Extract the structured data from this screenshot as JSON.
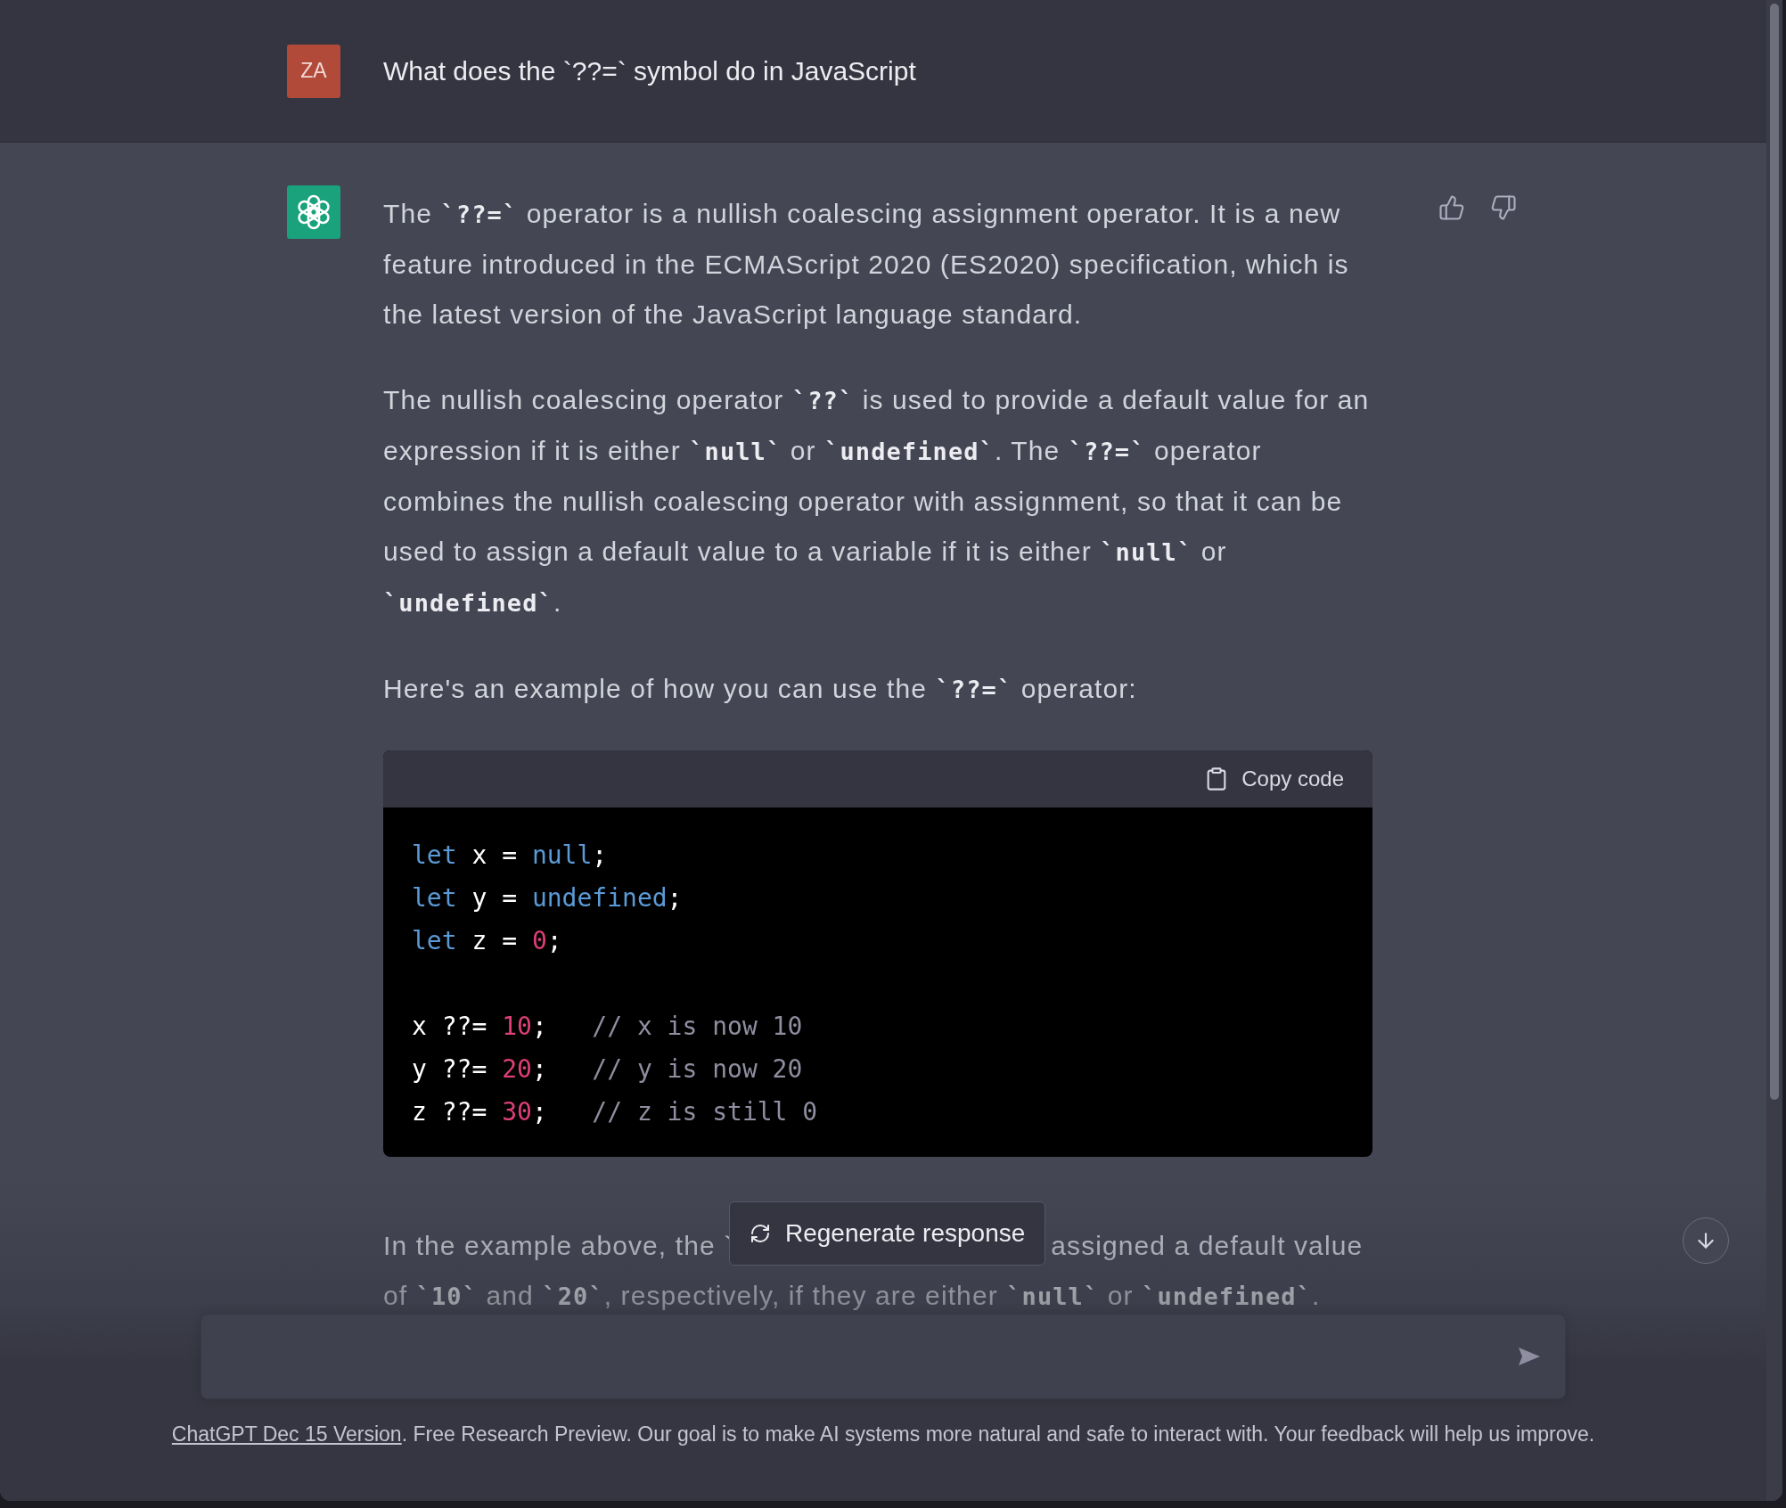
{
  "question": {
    "avatar": "ZA",
    "text": "What does the `??=` symbol do in JavaScript"
  },
  "answer": {
    "blocks": [
      {
        "kind": "paragraph",
        "segments": [
          {
            "text": "The "
          },
          {
            "text": "`??=`",
            "code": true
          },
          {
            "text": " operator is a nullish coalescing assignment operator. It is a new feature introduced in the ECMAScript 2020 (ES2020) specification, which is the latest version of the JavaScript language standard."
          }
        ]
      },
      {
        "kind": "paragraph",
        "segments": [
          {
            "text": "The nullish coalescing operator "
          },
          {
            "text": "`??`",
            "code": true
          },
          {
            "text": " is used to provide a default value for an expression if it is either "
          },
          {
            "text": "`null`",
            "code": true
          },
          {
            "text": " or "
          },
          {
            "text": "`undefined`",
            "code": true
          },
          {
            "text": ". The "
          },
          {
            "text": "`??=`",
            "code": true
          },
          {
            "text": " operator combines the nullish coalescing operator with assignment, so that it can be used to assign a default value to a variable if it is either "
          },
          {
            "text": "`null`",
            "code": true
          },
          {
            "text": " or "
          },
          {
            "text": "`undefined`",
            "code": true
          },
          {
            "text": "."
          }
        ]
      },
      {
        "kind": "paragraph",
        "segments": [
          {
            "text": "Here's an example of how you can use the "
          },
          {
            "text": "`??=`",
            "code": true
          },
          {
            "text": " operator:"
          }
        ]
      },
      {
        "kind": "code",
        "copy_label": "Copy code",
        "groups": [
          [
            [
              {
                "kind": "keyword",
                "text": "let"
              },
              {
                "kind": "plain",
                "text": " x = "
              },
              {
                "kind": "keyword",
                "text": "null"
              },
              {
                "kind": "plain",
                "text": ";"
              }
            ],
            [
              {
                "kind": "keyword",
                "text": "let"
              },
              {
                "kind": "plain",
                "text": " y = "
              },
              {
                "kind": "keyword",
                "text": "undefined"
              },
              {
                "kind": "plain",
                "text": ";"
              }
            ],
            [
              {
                "kind": "keyword",
                "text": "let"
              },
              {
                "kind": "plain",
                "text": " z = "
              },
              {
                "kind": "number",
                "text": "0"
              },
              {
                "kind": "plain",
                "text": ";"
              }
            ]
          ],
          [
            [
              {
                "kind": "plain",
                "text": "x ??= "
              },
              {
                "kind": "number",
                "text": "10"
              },
              {
                "kind": "plain",
                "text": ";   "
              },
              {
                "kind": "comment",
                "text": "// x is now 10"
              }
            ],
            [
              {
                "kind": "plain",
                "text": "y ??= "
              },
              {
                "kind": "number",
                "text": "20"
              },
              {
                "kind": "plain",
                "text": ";   "
              },
              {
                "kind": "comment",
                "text": "// y is now 20"
              }
            ],
            [
              {
                "kind": "plain",
                "text": "z ??= "
              },
              {
                "kind": "number",
                "text": "30"
              },
              {
                "kind": "plain",
                "text": ";   "
              },
              {
                "kind": "comment",
                "text": "// z is still 0"
              }
            ]
          ]
        ]
      },
      {
        "kind": "covered",
        "lines": [
          [
            [
              {
                "text": "In the example above, the `"
              }
            ],
            [
              {
                "text": "assigned a default value"
              }
            ]
          ],
          [
            [
              {
                "text": "of "
              },
              {
                "text": "`10`",
                "code": true
              },
              {
                "text": " and "
              },
              {
                "text": "`20`",
                "code": true
              },
              {
                "text": ", respectively, if they are either "
              },
              {
                "text": "`null`",
                "code": true
              },
              {
                "text": " or "
              },
              {
                "text": "`undefined`",
                "code": true
              },
              {
                "text": "."
              }
            ]
          ]
        ]
      }
    ]
  },
  "regenerate_button": "Regenerate response",
  "footer": {
    "link": "ChatGPT Dec 15 Version",
    "text": ". Free Research Preview. Our goal is to make AI systems more natural and safe to interact with. Your feedback will help us improve."
  }
}
